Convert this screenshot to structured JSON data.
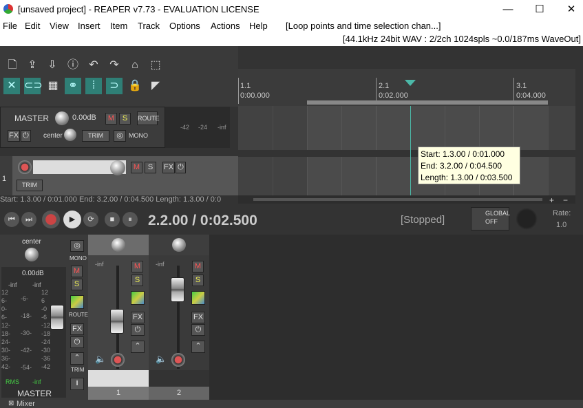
{
  "window": {
    "title": "[unsaved project] - REAPER v7.73 - EVALUATION LICENSE",
    "minimize": "—",
    "maximize": "☐",
    "close": "✕"
  },
  "menu": {
    "file": "File",
    "edit": "Edit",
    "view": "View",
    "insert": "Insert",
    "item": "Item",
    "track": "Track",
    "options": "Options",
    "actions": "Actions",
    "help": "Help",
    "loop_status": "[Loop points and time selection chan...]"
  },
  "audio_status": "[44.1kHz 24bit WAV : 2/2ch 1024spls ~0.0/187ms WaveOut]",
  "ruler": {
    "m1": "1.1",
    "t1": "0:00.000",
    "m2": "2.1",
    "t2": "0:02.000",
    "m3": "3.1",
    "t3": "0:04.000"
  },
  "master": {
    "label": "MASTER",
    "volume": "0.00dB",
    "pan": "center",
    "m": "M",
    "s": "S",
    "route": "ROUTE",
    "fx": "FX",
    "trim": "TRIM",
    "mono": "MONO",
    "meter": [
      "-42",
      "-24",
      "-inf"
    ]
  },
  "track1": {
    "number": "1",
    "m": "M",
    "s": "S",
    "fx": "FX",
    "trim": "TRIM"
  },
  "tooltip": {
    "start": "Start: 1.3.00 / 0:01.000",
    "end": "End: 3.2.00 / 0:04.500",
    "length": "Length: 1.3.00 / 0:03.500"
  },
  "selection_info": "Start: 1.3.00 / 0:01.000 End: 3.2.00 / 0:04.500 Length: 1.3.00 / 0:0",
  "transport": {
    "position": "2.2.00 / 0:02.500",
    "state": "[Stopped]",
    "global": "GLOBAL",
    "global_value": "OFF",
    "rate_label": "Rate:",
    "rate_value": "1.0"
  },
  "mixer": {
    "master_pan": "center",
    "mono": "MONO",
    "route": "ROUTE",
    "master_vol": "0.00dB",
    "inf_l": "-inf",
    "inf_r": "-inf",
    "rms": "RMS",
    "rms_val": "-inf",
    "master_name": "MASTER",
    "fx": "FX",
    "trim": "TRIM",
    "info": "i",
    "scale_left": [
      "12",
      "6-",
      "0-",
      "6-",
      "12-",
      "18-",
      "24-",
      "30-",
      "36-",
      "42-"
    ],
    "scale_mid": [
      "-6-",
      "-18-",
      "-30-",
      "-42-",
      "-54-"
    ],
    "scale_right": [
      "12",
      "6",
      "-0",
      "-6",
      "-12",
      "-18",
      "-24",
      "-30",
      "-36",
      "-42"
    ],
    "strips": [
      {
        "num": "1",
        "vol": "-inf",
        "m": "M",
        "s": "S",
        "fx": "FX"
      },
      {
        "num": "2",
        "vol": "-inf",
        "m": "M",
        "s": "S",
        "fx": "FX"
      }
    ]
  },
  "bottom_tab": "Mixer"
}
